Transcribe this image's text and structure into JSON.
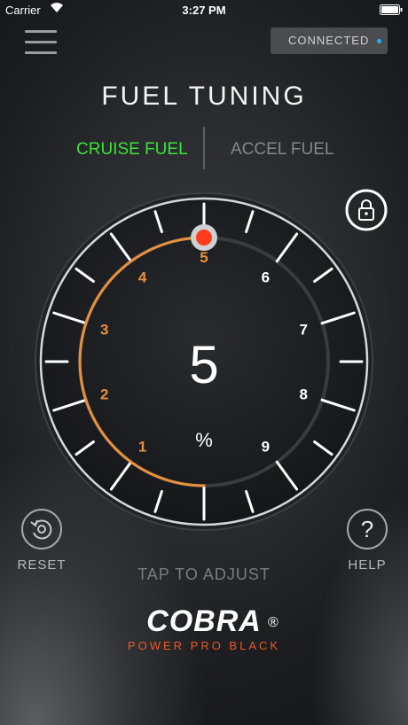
{
  "status": {
    "carrier": "Carrier",
    "time": "3:27 PM"
  },
  "connection": {
    "label": "CONNECTED",
    "indicator_color": "#24aef0"
  },
  "title": "FUEL TUNING",
  "tabs": [
    {
      "label": "CRUISE FUEL",
      "active": true,
      "color": "#3ae23a"
    },
    {
      "label": "ACCEL FUEL",
      "active": false,
      "color": "#85878b"
    }
  ],
  "gauge": {
    "value": "5",
    "unit": "%",
    "current": 5,
    "min": 0,
    "max": 10,
    "scale_labels": [
      "1",
      "2",
      "3",
      "4",
      "5",
      "6",
      "7",
      "8",
      "9"
    ],
    "arc_color": "#e8913c",
    "knob_color": "#ff3d1a"
  },
  "reset": {
    "label": "RESET"
  },
  "help": {
    "label": "HELP",
    "glyph": "?"
  },
  "hint": "TAP TO ADJUST",
  "brand": {
    "name": "COBRA",
    "reg": "®",
    "tagline": "POWER PRO BLACK",
    "accent": "#ea5a24"
  },
  "icons": [
    "menu-icon",
    "wifi-icon",
    "battery-icon",
    "lock-icon",
    "reset-icon",
    "help-icon"
  ]
}
